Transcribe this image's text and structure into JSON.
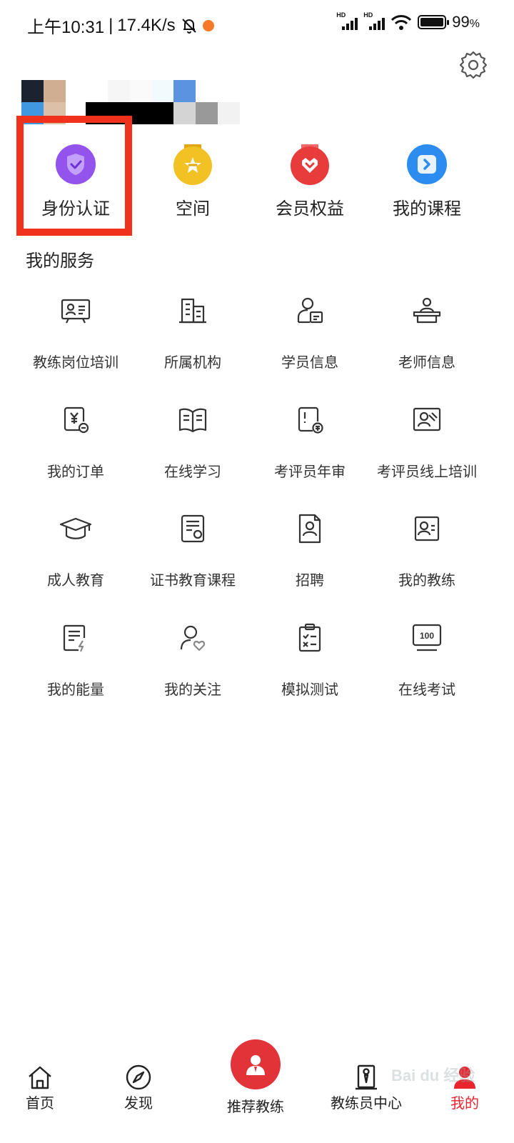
{
  "status_bar": {
    "time": "上午10:31",
    "speed": "17.4K/s",
    "battery": "99",
    "battery_unit": "%",
    "network_1": "HD",
    "network_2": "HD",
    "battery_level": 0.99
  },
  "colors": {
    "accent": "#e8242f",
    "highlight": "#f0321c",
    "purple": "#9b59f5",
    "gold": "#f2c224",
    "red": "#e83b3b",
    "blue": "#2d8cf0"
  },
  "quick_entries": [
    {
      "label": "身份认证",
      "icon": "shield-check-icon"
    },
    {
      "label": "空间",
      "icon": "star-badge-icon"
    },
    {
      "label": "会员权益",
      "icon": "heart-badge-icon"
    },
    {
      "label": "我的课程",
      "icon": "play-course-icon"
    }
  ],
  "section_title": "我的服务",
  "services": [
    {
      "label": "教练岗位培训",
      "icon": "training-board-icon"
    },
    {
      "label": "所属机构",
      "icon": "building-icon"
    },
    {
      "label": "学员信息",
      "icon": "student-card-icon"
    },
    {
      "label": "老师信息",
      "icon": "teacher-desk-icon"
    },
    {
      "label": "我的订单",
      "icon": "order-yuan-icon"
    },
    {
      "label": "在线学习",
      "icon": "open-book-icon"
    },
    {
      "label": "考评员年审",
      "icon": "review-doc-icon"
    },
    {
      "label": "考评员线上培训",
      "icon": "online-training-icon"
    },
    {
      "label": "成人教育",
      "icon": "graduation-cap-icon"
    },
    {
      "label": "证书教育课程",
      "icon": "certificate-icon"
    },
    {
      "label": "招聘",
      "icon": "recruit-doc-icon"
    },
    {
      "label": "我的教练",
      "icon": "coach-card-icon"
    },
    {
      "label": "我的能量",
      "icon": "energy-doc-icon"
    },
    {
      "label": "我的关注",
      "icon": "follow-user-icon"
    },
    {
      "label": "模拟测试",
      "icon": "checklist-icon"
    },
    {
      "label": "在线考试",
      "icon": "exam-score-icon"
    }
  ],
  "bottom_nav": [
    {
      "label": "首页",
      "icon": "home-icon"
    },
    {
      "label": "发现",
      "icon": "compass-icon"
    },
    {
      "label": "推荐教练",
      "icon": "coach-avatar-icon"
    },
    {
      "label": "教练员中心",
      "icon": "coach-center-icon"
    },
    {
      "label": "我的",
      "icon": "user-icon"
    }
  ],
  "watermark": "Bai du 经验"
}
